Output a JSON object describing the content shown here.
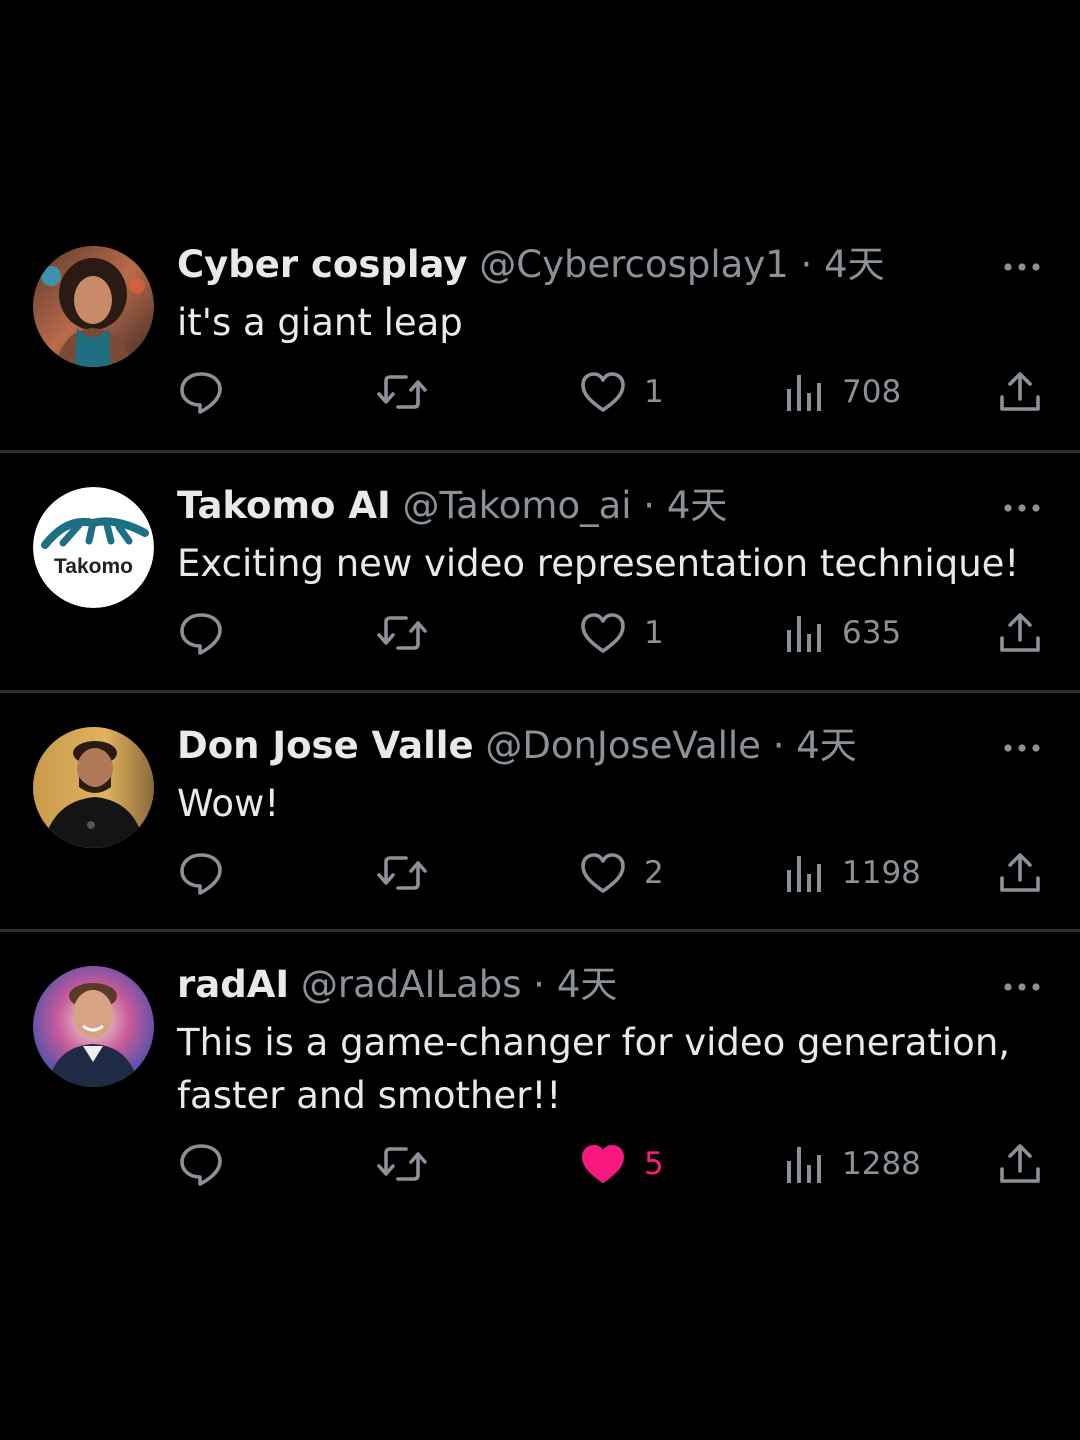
{
  "colors": {
    "background": "#000000",
    "text": "#e7e9ea",
    "secondary": "#8b9198",
    "divider": "#2a2d31",
    "liked": "#f91880"
  },
  "icons": {
    "reply": "speech-bubble-icon",
    "retweet": "retweet-arrows-icon",
    "like": "heart-icon",
    "views": "bar-chart-icon",
    "share": "share-upload-icon",
    "more": "more-dots-icon"
  },
  "tweets": [
    {
      "name": "Cyber cosplay",
      "handle": "@Cybercosplay1",
      "separator": "·",
      "time": "4天",
      "text": "it's a giant leap",
      "likes": "1",
      "views": "708",
      "liked": false,
      "avatar": "portrait-woman-avatar"
    },
    {
      "name": "Takomo AI",
      "handle": "@Takomo_ai",
      "separator": "·",
      "time": "4天",
      "text": "Exciting new video representation technique!",
      "likes": "1",
      "views": "635",
      "liked": false,
      "avatar": "takomo-logo-avatar",
      "avatar_logo_text": "Takomo"
    },
    {
      "name": "Don Jose Valle",
      "handle": "@DonJoseValle",
      "separator": "·",
      "time": "4天",
      "text": "Wow!",
      "likes": "2",
      "views": "1198",
      "liked": false,
      "avatar": "portrait-man-avatar"
    },
    {
      "name": "radAI",
      "handle": "@radAILabs",
      "separator": "·",
      "time": "4天",
      "text": "This is a game-changer for video generation, faster and smother!!",
      "likes": "5",
      "views": "1288",
      "liked": true,
      "avatar": "portrait-smiling-man-avatar"
    }
  ]
}
